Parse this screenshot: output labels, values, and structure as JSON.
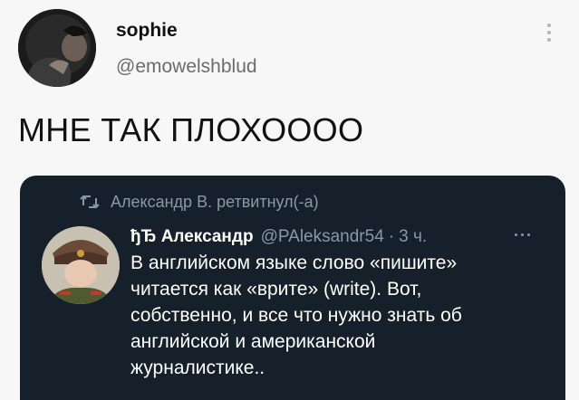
{
  "tweet": {
    "display_name": "sophie",
    "handle": "@emowelshblud",
    "text": "МНЕ ТАК ПЛОХОООО",
    "menu_icon": "more-vertical-icon"
  },
  "quoted": {
    "retweet_label": "Александр В. ретвитнул(-а)",
    "retweet_icon": "retweet-icon",
    "display_name": "ђЂ Александр",
    "handle": "@PAleksandr54",
    "separator": "·",
    "time": "3 ч.",
    "more_icon": "more-horizontal-icon",
    "lines": [
      "В английском языке слово «пишите»",
      "читается как «врите» (write). Вот,",
      "собственно, и все что нужно знать об",
      "английской и американской",
      "журналистике.."
    ],
    "colors": {
      "card_bg": "#15202b",
      "muted": "#8899a6",
      "text": "#ffffff"
    }
  }
}
